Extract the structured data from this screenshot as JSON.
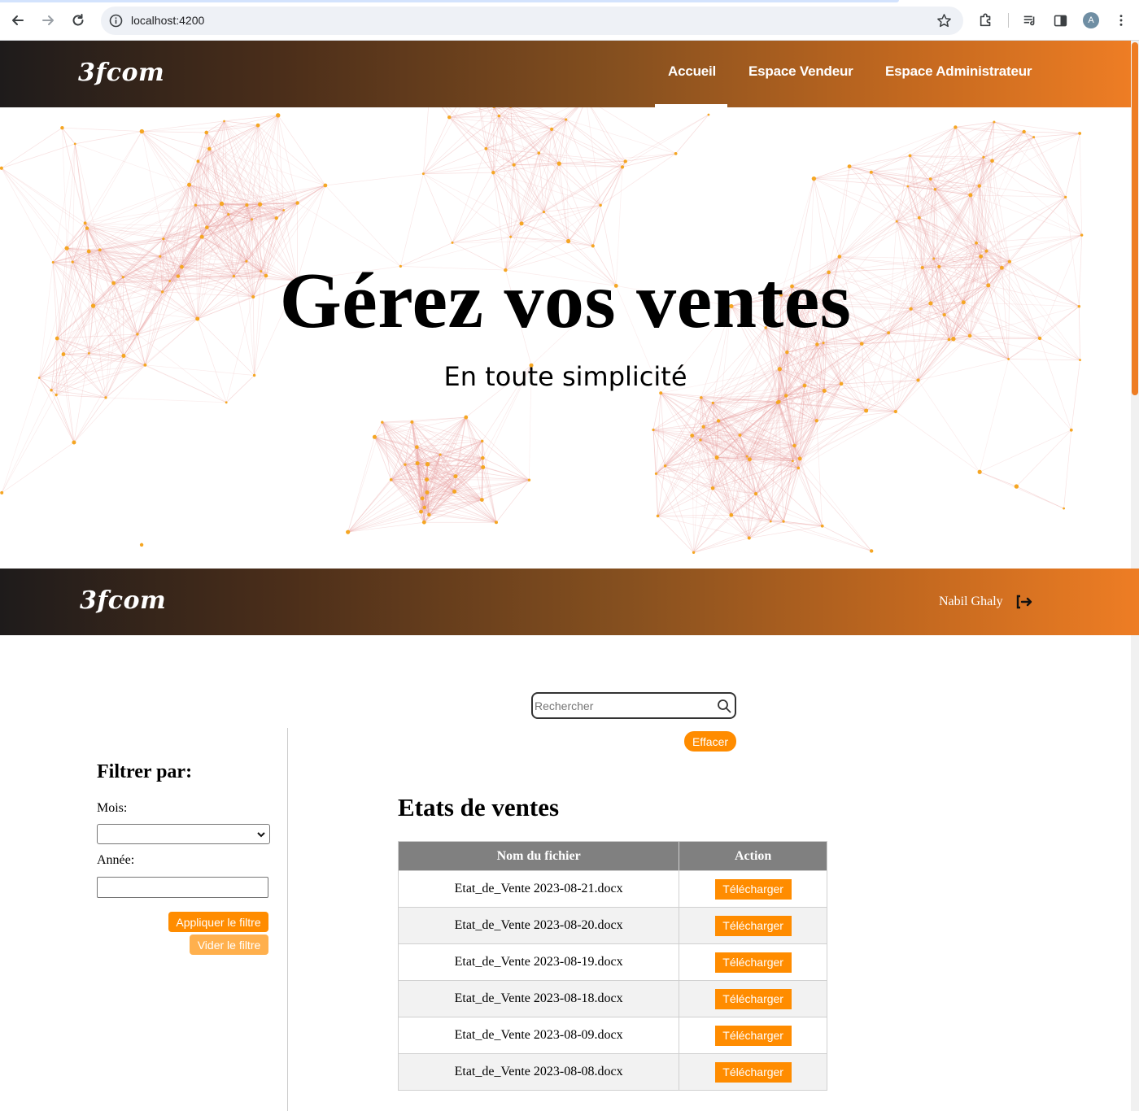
{
  "browser": {
    "url": "localhost:4200",
    "profile_initial": "A",
    "icons": [
      "back-icon",
      "forward-icon",
      "reload-icon",
      "site-info-icon",
      "bookmark-star-icon",
      "extensions-icon",
      "media-queue-icon",
      "side-panel-icon",
      "more-menu-icon"
    ]
  },
  "topnav": {
    "logo": "3fcom",
    "links": [
      "Accueil",
      "Espace Vendeur",
      "Espace Administrateur"
    ],
    "active": "Accueil"
  },
  "hero": {
    "title": "Gérez vos ventes",
    "subtitle": "En toute simplicité"
  },
  "subheader": {
    "logo": "3fcom",
    "user_name": "Nabil Ghaly",
    "logout_icon": "logout-icon"
  },
  "search": {
    "placeholder": "Rechercher",
    "value": "",
    "clear_label": "Effacer"
  },
  "filter": {
    "title": "Filtrer par:",
    "month_label": "Mois:",
    "month_value": "",
    "year_label": "Année:",
    "year_value": "",
    "apply_label": "Appliquer le filtre",
    "clear_label": "Vider le filtre"
  },
  "sales_table": {
    "title": "Etats de ventes",
    "columns": [
      "Nom du fichier",
      "Action"
    ],
    "rows": [
      {
        "file": "Etat_de_Vente 2023-08-21.docx",
        "action": "Télécharger"
      },
      {
        "file": "Etat_de_Vente 2023-08-20.docx",
        "action": "Télécharger"
      },
      {
        "file": "Etat_de_Vente 2023-08-19.docx",
        "action": "Télécharger"
      },
      {
        "file": "Etat_de_Vente 2023-08-18.docx",
        "action": "Télécharger"
      },
      {
        "file": "Etat_de_Vente 2023-08-09.docx",
        "action": "Télécharger"
      },
      {
        "file": "Etat_de_Vente 2023-08-08.docx",
        "action": "Télécharger"
      }
    ]
  },
  "colors": {
    "accent": "#ff8c00",
    "header_gradient_start": "#1e1b1b",
    "header_gradient_end": "#ee7d24",
    "table_header": "#808080",
    "network_line": "#e8a0a0",
    "network_node": "#f5a623"
  }
}
